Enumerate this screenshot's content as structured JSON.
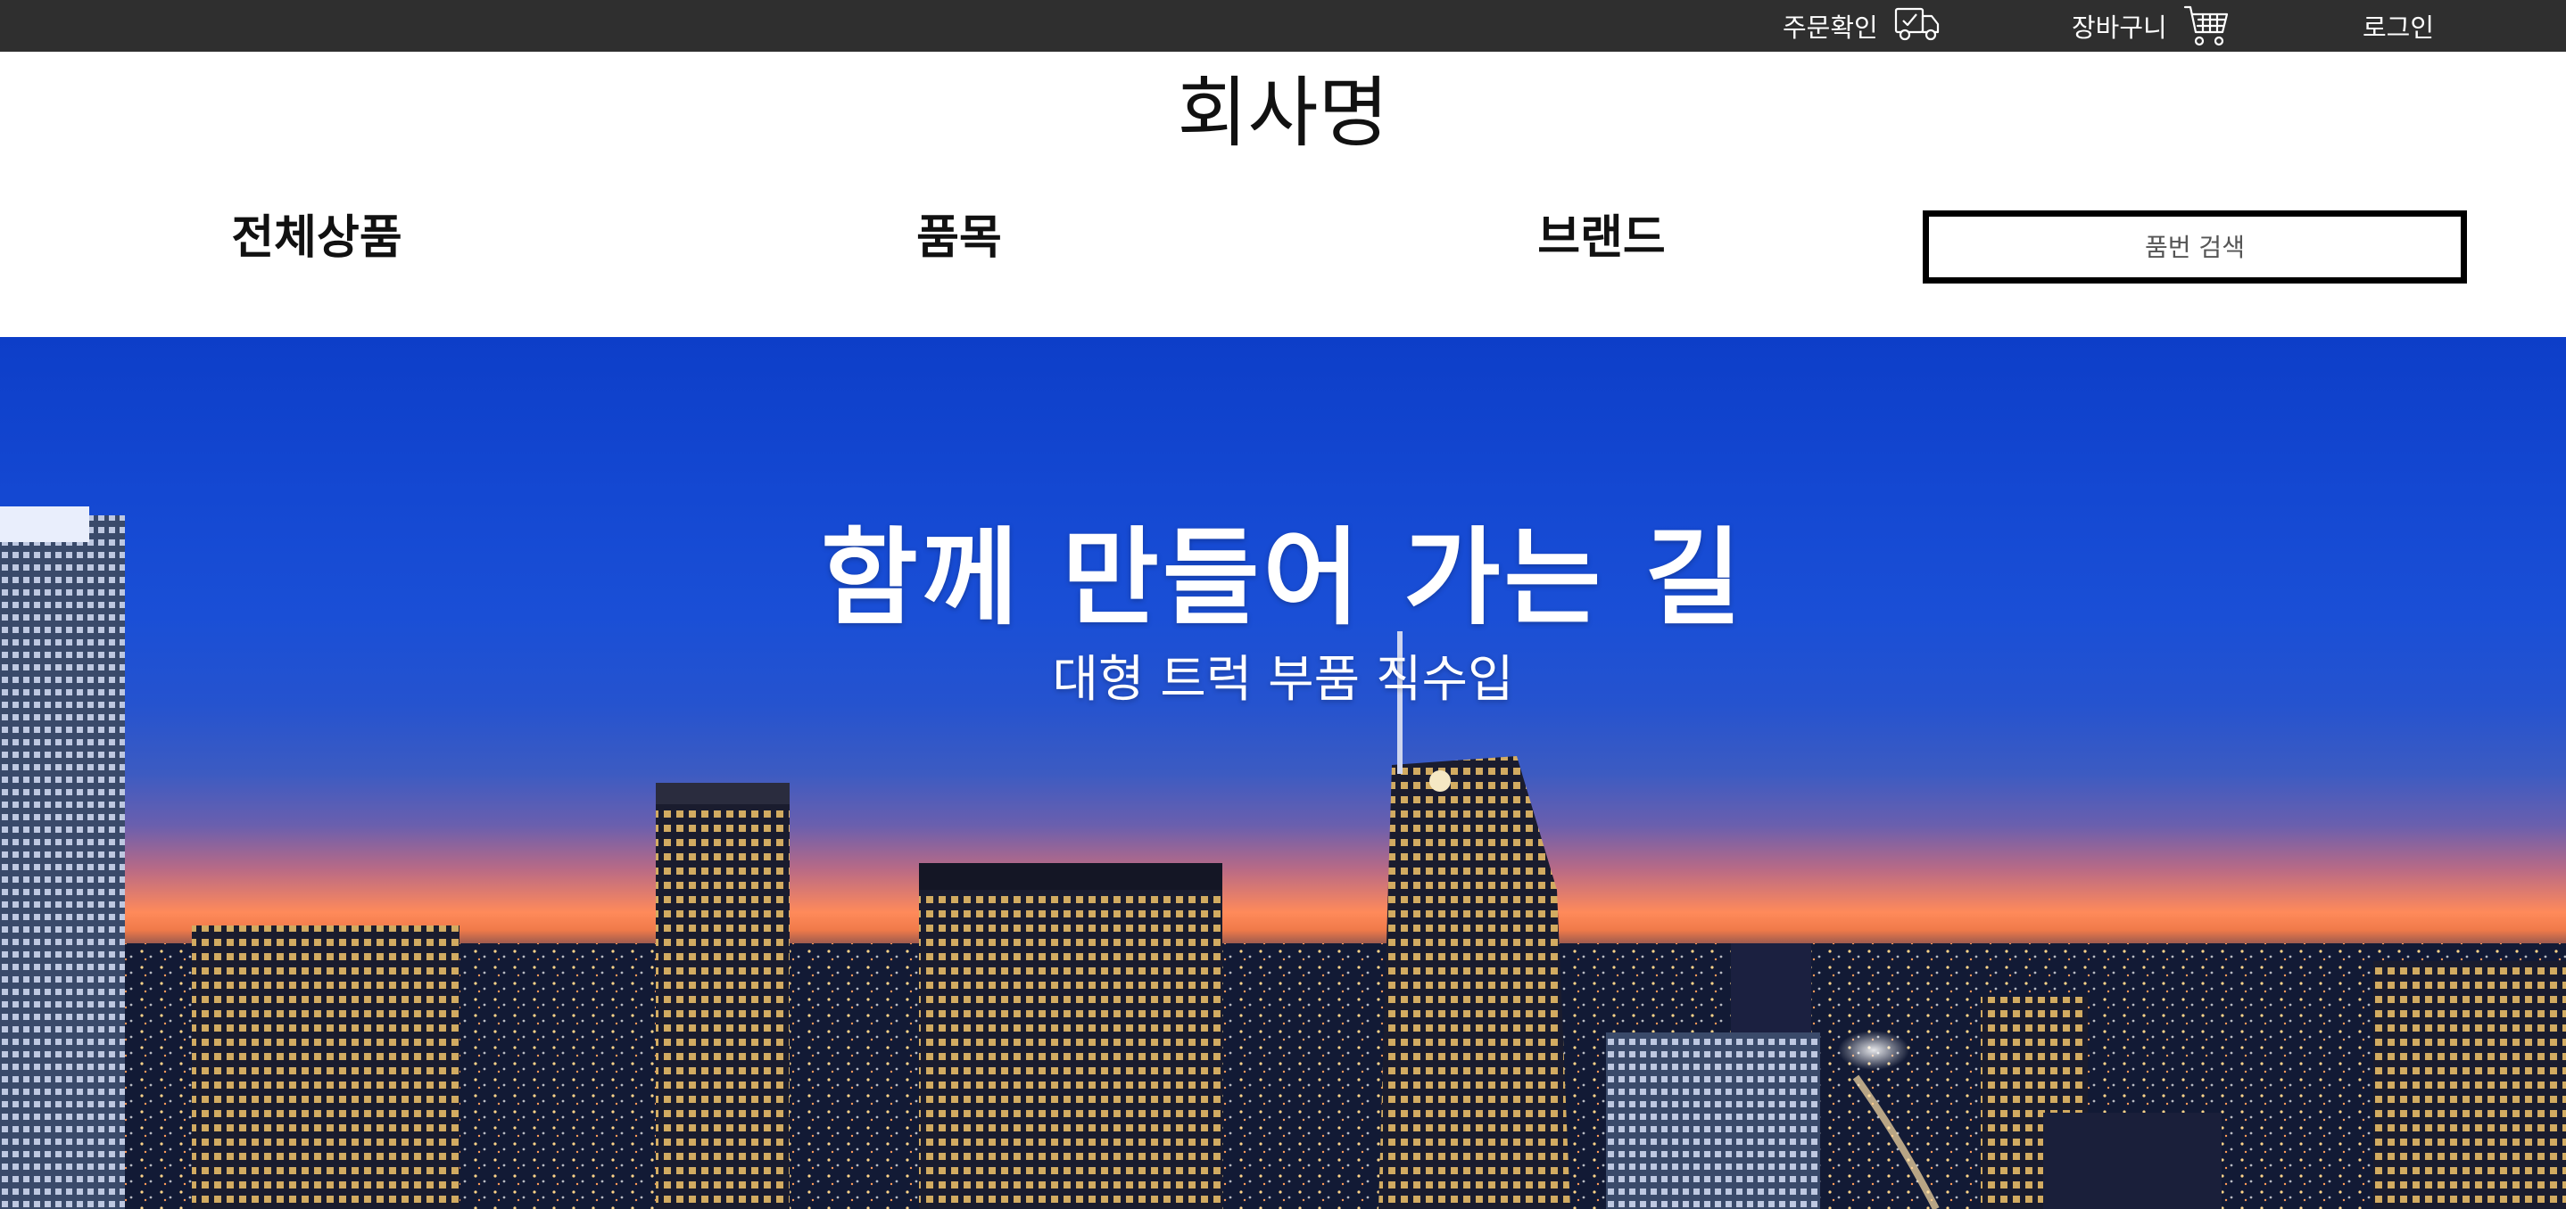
{
  "topbar": {
    "order_label": "주문확인",
    "order_icon": "delivery-truck-icon",
    "cart_label": "장바구니",
    "cart_icon": "shopping-cart-icon",
    "login_label": "로그인",
    "background": "#2f2f2f"
  },
  "header": {
    "logo": "회사명"
  },
  "nav": {
    "items": [
      {
        "label": "전체상품"
      },
      {
        "label": "품목"
      },
      {
        "label": "브랜드"
      }
    ],
    "search_placeholder": "품번 검색"
  },
  "hero": {
    "title": "함께 만들어 가는 길",
    "subtitle": "대형 트럭 부품 직수입",
    "sky_top_color": "#0d3ec8",
    "horizon_color": "#ff8a5a"
  }
}
